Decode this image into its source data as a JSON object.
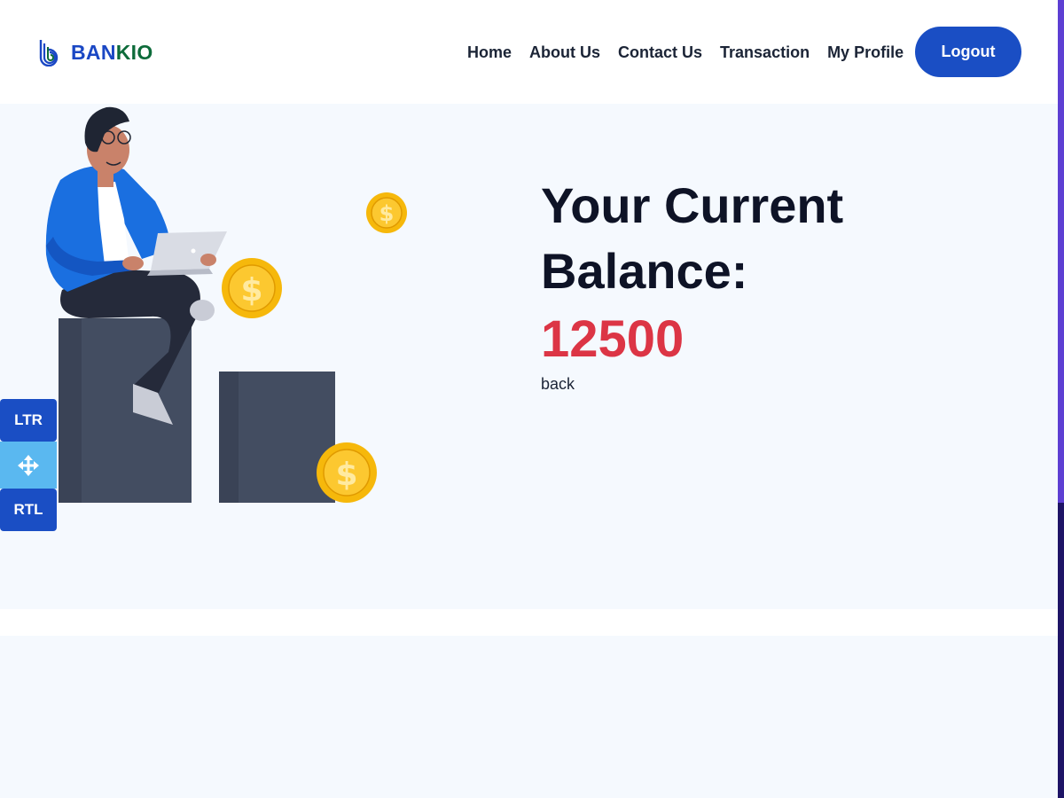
{
  "brand": {
    "part1": "BAN",
    "part2": "KIO",
    "accent": "#1a47c4",
    "accent2": "#0d6b3a"
  },
  "nav": {
    "items": [
      {
        "label": "Home"
      },
      {
        "label": "About Us"
      },
      {
        "label": "Contact Us"
      },
      {
        "label": "Transaction"
      },
      {
        "label": "My Profile"
      }
    ],
    "logout_label": "Logout"
  },
  "balance": {
    "title": "Your Current Balance:",
    "value": "12500",
    "value_color": "#dc3545",
    "back_label": "back"
  },
  "direction_switch": {
    "ltr_label": "LTR",
    "rtl_label": "RTL",
    "move_icon": "move-arrows-icon"
  },
  "icons": {
    "coin": "dollar-coin-icon",
    "logo": "bankio-logo-icon"
  }
}
